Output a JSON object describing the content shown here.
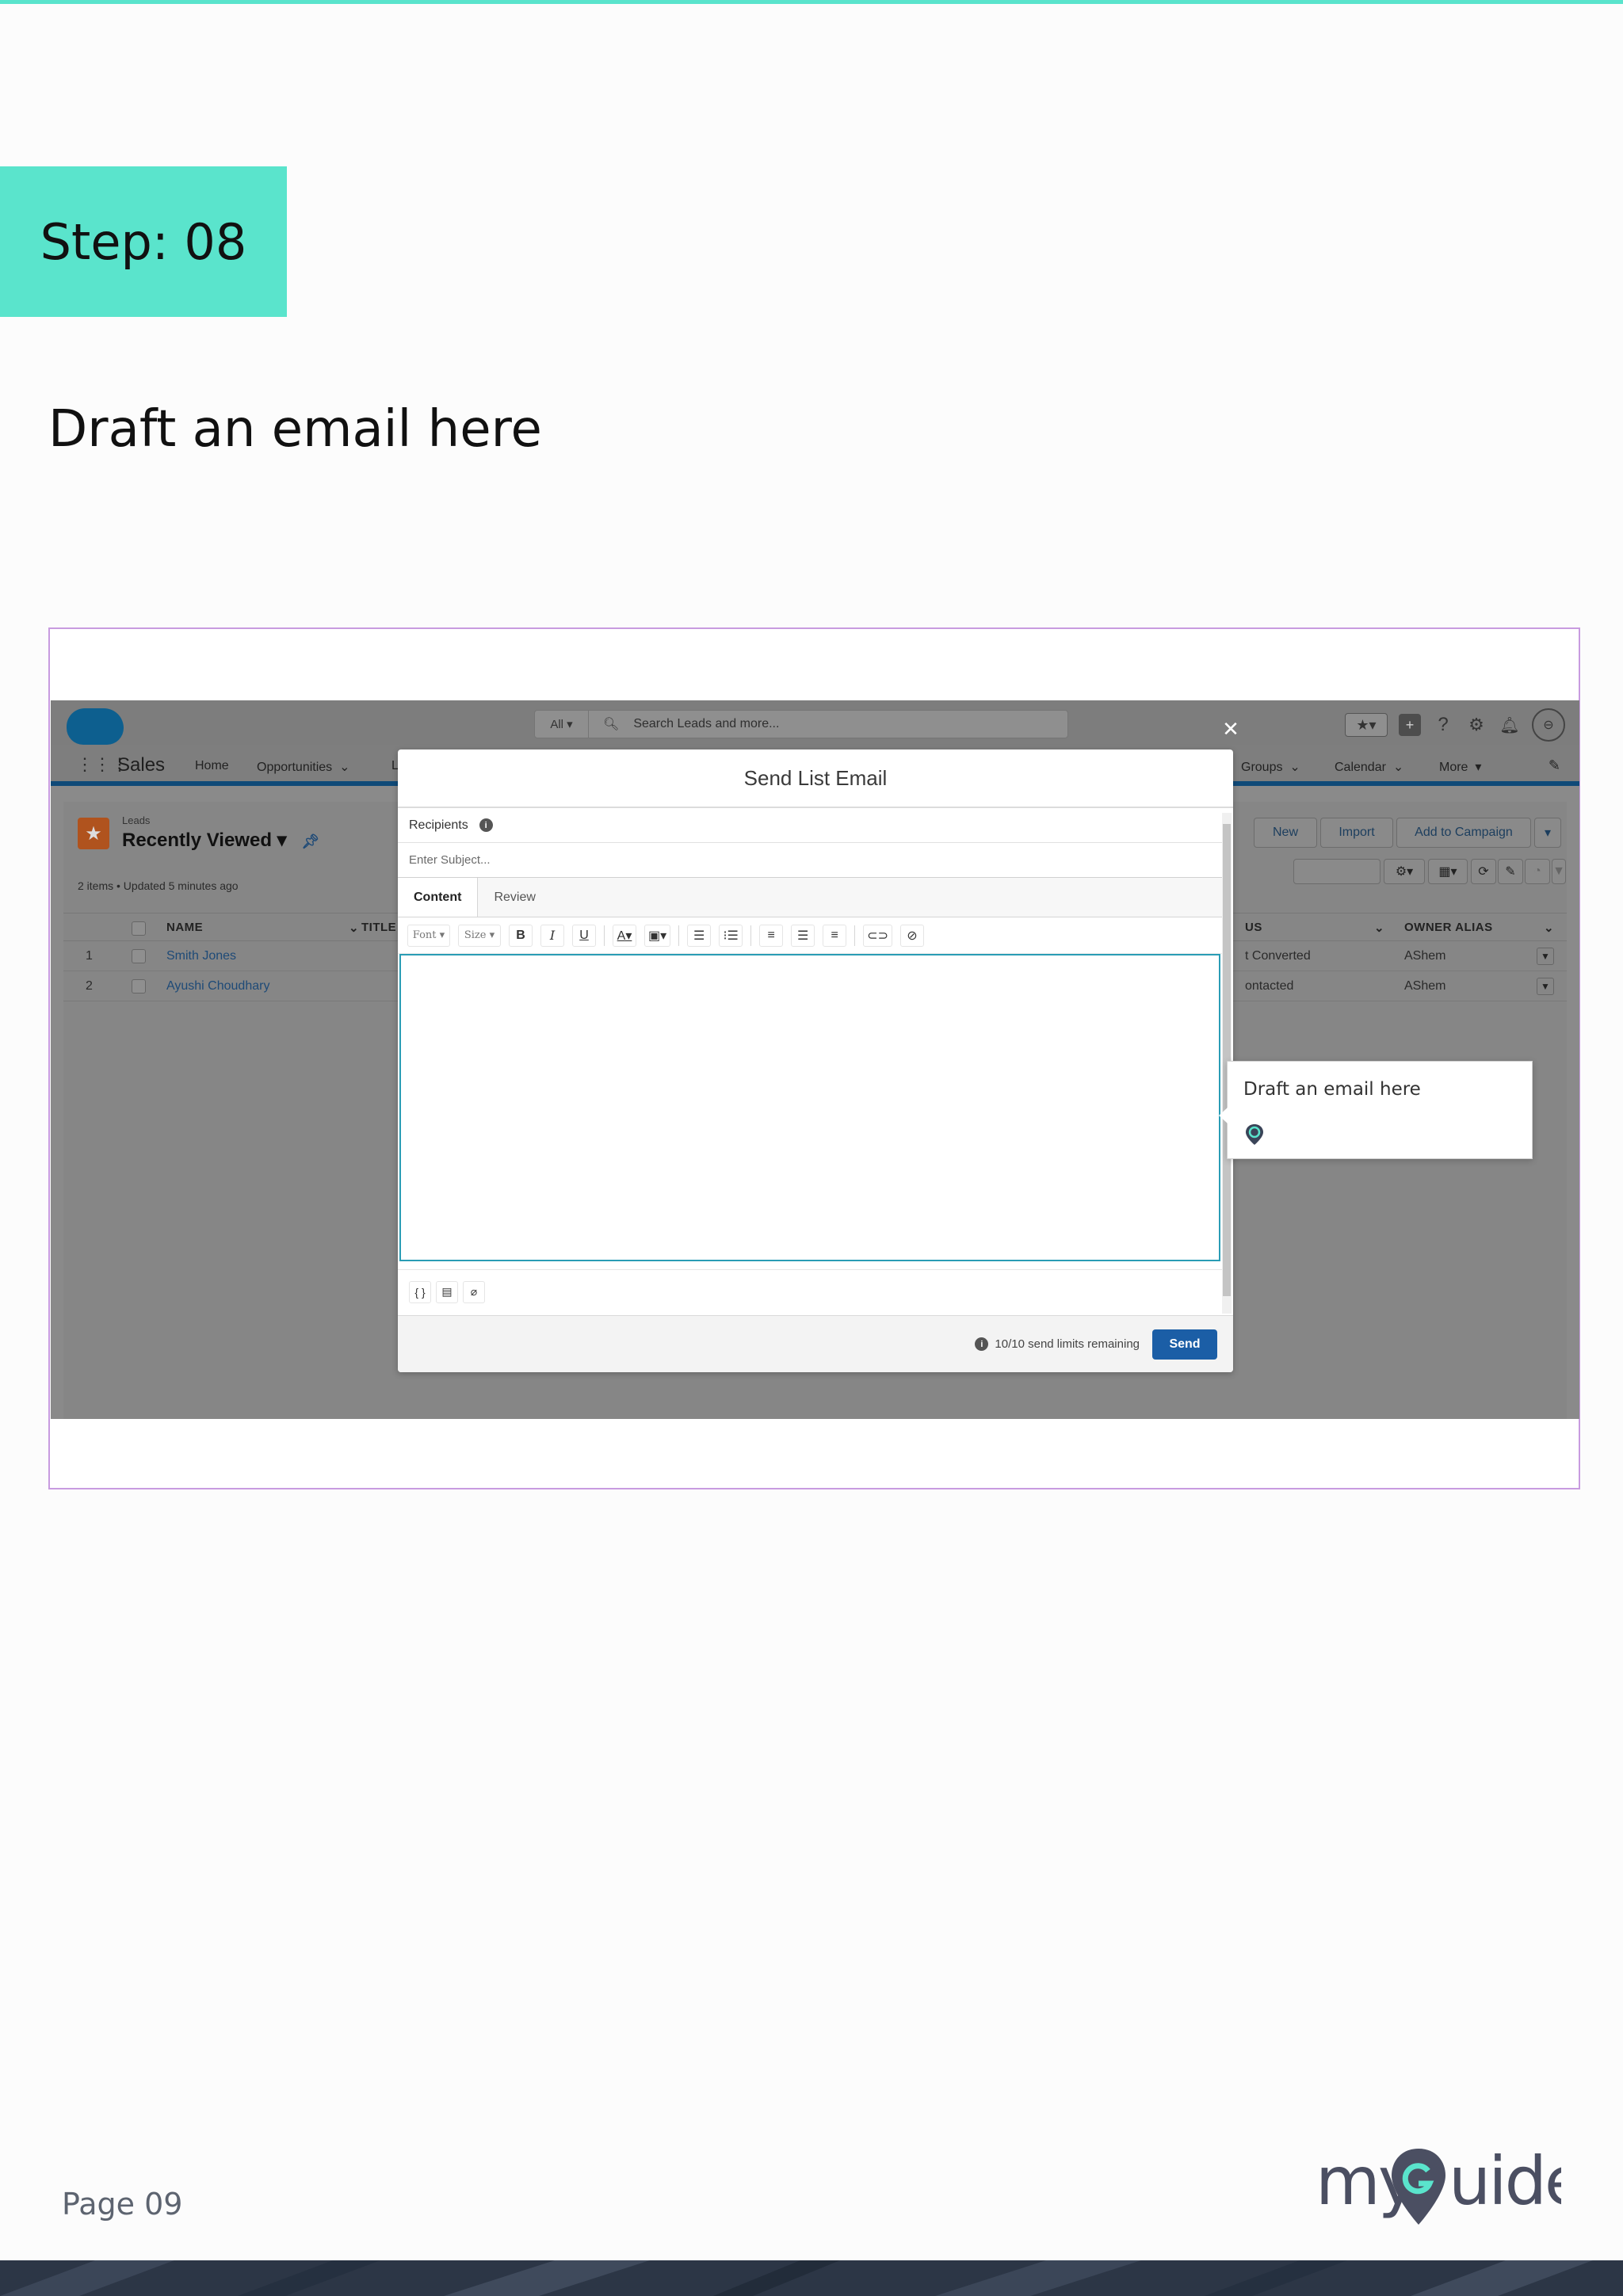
{
  "step": {
    "label": "Step: 08"
  },
  "instruction": "Draft an email here",
  "screenshot": {
    "search": {
      "scope": "All",
      "placeholder": "Search Leads and more..."
    },
    "app_name": "Sales",
    "nav_items": [
      "Home",
      "Opportunities",
      "L",
      "Groups",
      "Calendar",
      "More"
    ],
    "list": {
      "object_label": "Leads",
      "view_name": "Recently Viewed",
      "meta": "2 items • Updated 5 minutes ago",
      "buttons": [
        "New",
        "Import",
        "Add to Campaign"
      ],
      "columns": [
        "NAME",
        "TITLE",
        "US",
        "OWNER ALIAS"
      ],
      "rows": [
        {
          "num": "1",
          "name": "Smith Jones",
          "status": "t Converted",
          "owner": "AShem"
        },
        {
          "num": "2",
          "name": "Ayushi Choudhary",
          "status": "ontacted",
          "owner": "AShem"
        }
      ]
    },
    "modal": {
      "title": "Send List Email",
      "recipients_label": "Recipients",
      "subject_placeholder": "Enter Subject...",
      "tabs": [
        "Content",
        "Review"
      ],
      "toolbar": {
        "font": "Font",
        "size": "Size"
      },
      "limit_text": "10/10 send limits remaining",
      "send_label": "Send"
    },
    "tooltip": {
      "text": "Draft an email here"
    }
  },
  "footer": {
    "page": "Page 09",
    "brand": "myGuide"
  },
  "colors": {
    "accent": "#5ae4cc",
    "frame": "#c89be0",
    "send": "#1b5ea6",
    "footer": "#2c3646"
  }
}
